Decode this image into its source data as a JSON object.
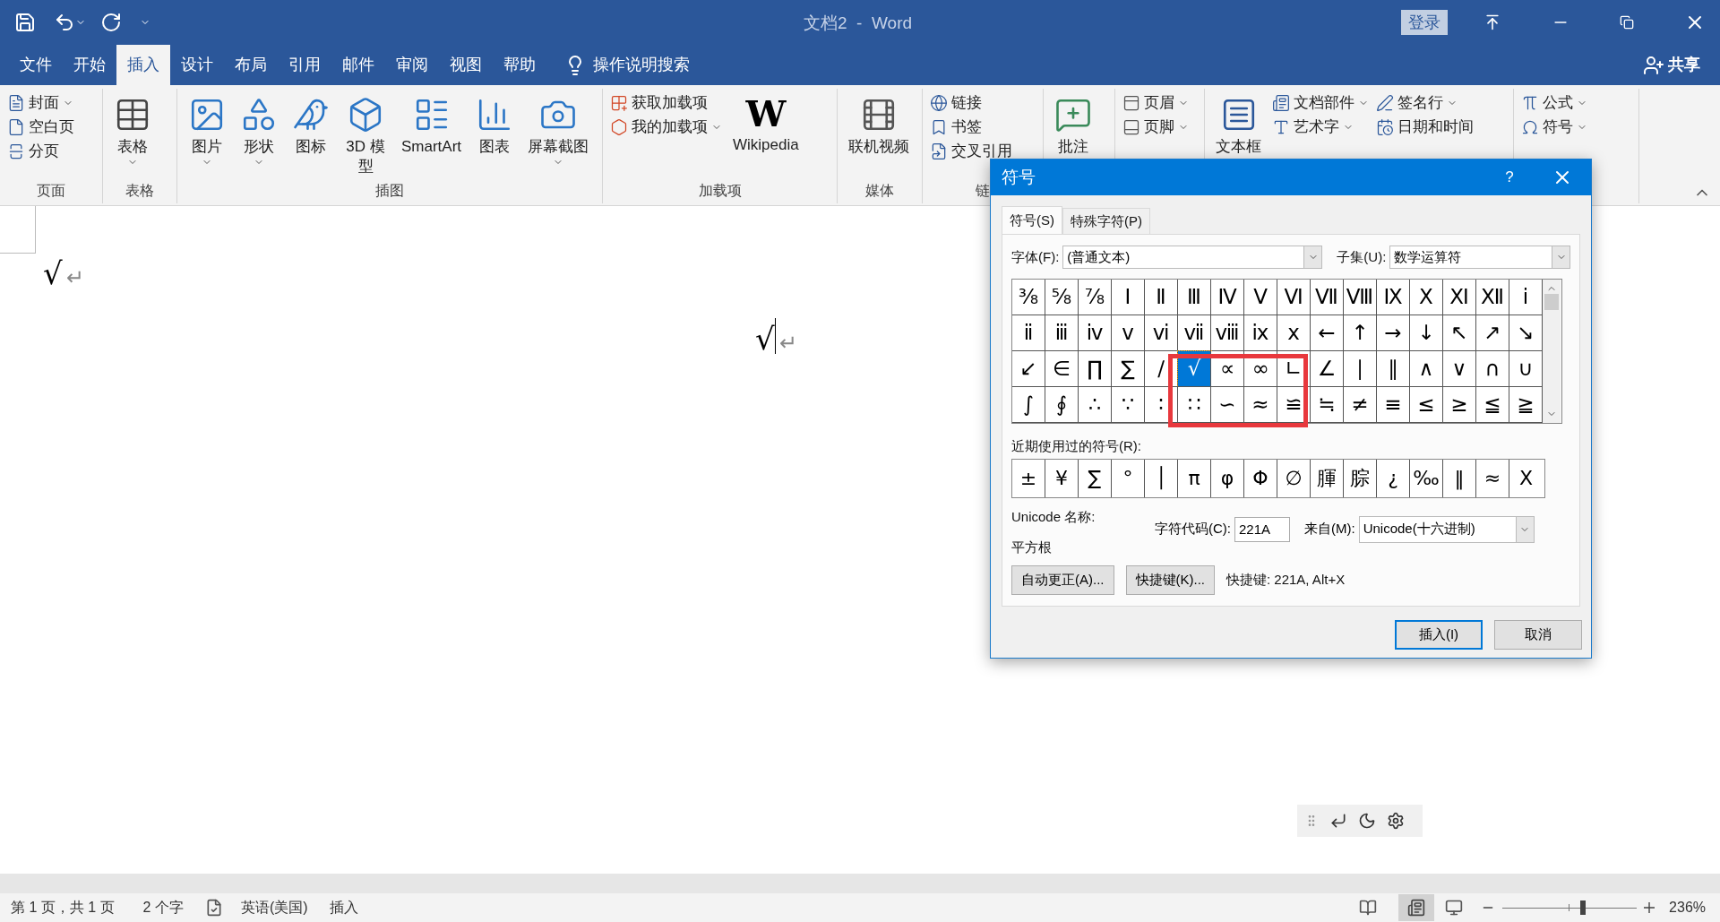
{
  "window": {
    "title": "文档2  -  Word",
    "signin": "登录"
  },
  "menu_tabs": [
    {
      "label": "文件",
      "selected": false
    },
    {
      "label": "开始",
      "selected": false
    },
    {
      "label": "插入",
      "selected": true
    },
    {
      "label": "设计",
      "selected": false
    },
    {
      "label": "布局",
      "selected": false
    },
    {
      "label": "引用",
      "selected": false
    },
    {
      "label": "邮件",
      "selected": false
    },
    {
      "label": "审阅",
      "selected": false
    },
    {
      "label": "视图",
      "selected": false
    },
    {
      "label": "帮助",
      "selected": false
    }
  ],
  "tell_me": "操作说明搜索",
  "share": "共享",
  "ribbon": {
    "groups": [
      {
        "label": "页面",
        "items": [
          {
            "label": "封面",
            "kind": "small",
            "dropdown": true
          },
          {
            "label": "空白页",
            "kind": "small",
            "dropdown": false
          },
          {
            "label": "分页",
            "kind": "small",
            "dropdown": false
          }
        ]
      },
      {
        "label": "表格",
        "items": [
          {
            "label": "表格",
            "kind": "large",
            "dropdown": true
          }
        ]
      },
      {
        "label": "插图",
        "items": [
          {
            "label": "图片",
            "kind": "large",
            "dropdown": true
          },
          {
            "label": "形状",
            "kind": "large",
            "dropdown": true
          },
          {
            "label": "图标",
            "kind": "large",
            "dropdown": false
          },
          {
            "label": "3D 模型",
            "kind": "large",
            "dropdown": false
          },
          {
            "label": "SmartArt",
            "kind": "large",
            "dropdown": false
          },
          {
            "label": "图表",
            "kind": "large",
            "dropdown": false
          },
          {
            "label": "屏幕截图",
            "kind": "large",
            "dropdown": true
          }
        ]
      },
      {
        "label": "加载项",
        "items": [
          {
            "label": "获取加载项",
            "kind": "small",
            "dropdown": false
          },
          {
            "label": "我的加载项",
            "kind": "small",
            "dropdown": true
          },
          {
            "label": "Wikipedia",
            "kind": "large",
            "dropdown": false,
            "logo": "W"
          }
        ]
      },
      {
        "label": "媒体",
        "items": [
          {
            "label": "联机视频",
            "kind": "large",
            "dropdown": false
          }
        ]
      },
      {
        "label": "链",
        "items": [
          {
            "label": "链接",
            "kind": "small",
            "dropdown": false
          },
          {
            "label": "书签",
            "kind": "small",
            "dropdown": false
          },
          {
            "label": "交叉引用",
            "kind": "small",
            "dropdown": false
          }
        ]
      },
      {
        "items": [
          {
            "label": "批注",
            "kind": "large",
            "dropdown": false
          }
        ]
      },
      {
        "items": [
          {
            "label": "页眉",
            "kind": "small",
            "dropdown": true
          },
          {
            "label": "页脚",
            "kind": "small",
            "dropdown": true
          }
        ]
      },
      {
        "items": [
          {
            "label": "文本框",
            "kind": "large",
            "dropdown": false
          },
          {
            "label": "文档部件",
            "kind": "small",
            "dropdown": true
          },
          {
            "label": "艺术字",
            "kind": "small",
            "dropdown": true
          },
          {
            "label": "签名行",
            "kind": "small",
            "dropdown": true
          },
          {
            "label": "日期和时间",
            "kind": "small",
            "dropdown": false
          }
        ]
      },
      {
        "items": [
          {
            "label": "公式",
            "kind": "small",
            "dropdown": true
          },
          {
            "label": "符号",
            "kind": "small",
            "dropdown": true
          }
        ]
      }
    ]
  },
  "document": {
    "paragraphs": [
      {
        "text": "√",
        "mark": "↵"
      },
      {
        "text": "√",
        "mark": "↵"
      }
    ]
  },
  "dialog": {
    "title": "符号",
    "help": "?",
    "tabs": [
      {
        "label": "符号(S)",
        "selected": true
      },
      {
        "label": "特殊字符(P)",
        "selected": false
      }
    ],
    "font_label": "字体(F):",
    "font_value": "(普通文本)",
    "subset_label": "子集(U):",
    "subset_value": "数学运算符",
    "symbols": [
      [
        {
          "s": "⅜",
          "selected": false
        },
        {
          "s": "⅝",
          "selected": false
        },
        {
          "s": "⅞",
          "selected": false
        },
        {
          "s": "Ⅰ",
          "selected": false
        },
        {
          "s": "Ⅱ",
          "selected": false
        },
        {
          "s": "Ⅲ",
          "selected": false
        },
        {
          "s": "Ⅳ",
          "selected": false
        },
        {
          "s": "Ⅴ",
          "selected": false
        },
        {
          "s": "Ⅵ",
          "selected": false
        },
        {
          "s": "Ⅶ",
          "selected": false
        },
        {
          "s": "Ⅷ",
          "selected": false
        },
        {
          "s": "Ⅸ",
          "selected": false
        },
        {
          "s": "Ⅹ",
          "selected": false
        },
        {
          "s": "Ⅺ",
          "selected": false
        },
        {
          "s": "Ⅻ",
          "selected": false
        },
        {
          "s": "ⅰ",
          "selected": false
        }
      ],
      [
        {
          "s": "ⅱ",
          "selected": false
        },
        {
          "s": "ⅲ",
          "selected": false
        },
        {
          "s": "ⅳ",
          "selected": false
        },
        {
          "s": "ⅴ",
          "selected": false
        },
        {
          "s": "ⅵ",
          "selected": false
        },
        {
          "s": "ⅶ",
          "selected": false
        },
        {
          "s": "ⅷ",
          "selected": false
        },
        {
          "s": "ⅸ",
          "selected": false
        },
        {
          "s": "ⅹ",
          "selected": false
        },
        {
          "s": "←",
          "selected": false
        },
        {
          "s": "↑",
          "selected": false
        },
        {
          "s": "→",
          "selected": false
        },
        {
          "s": "↓",
          "selected": false
        },
        {
          "s": "↖",
          "selected": false
        },
        {
          "s": "↗",
          "selected": false
        },
        {
          "s": "↘",
          "selected": false
        }
      ],
      [
        {
          "s": "↙",
          "selected": false
        },
        {
          "s": "∈",
          "selected": false
        },
        {
          "s": "∏",
          "selected": false
        },
        {
          "s": "∑",
          "selected": false
        },
        {
          "s": "∕",
          "selected": false
        },
        {
          "s": "√",
          "selected": true
        },
        {
          "s": "∝",
          "selected": false
        },
        {
          "s": "∞",
          "selected": false
        },
        {
          "s": "∟",
          "selected": false
        },
        {
          "s": "∠",
          "selected": false
        },
        {
          "s": "∣",
          "selected": false
        },
        {
          "s": "∥",
          "selected": false
        },
        {
          "s": "∧",
          "selected": false
        },
        {
          "s": "∨",
          "selected": false
        },
        {
          "s": "∩",
          "selected": false
        },
        {
          "s": "∪",
          "selected": false
        }
      ],
      [
        {
          "s": "∫",
          "selected": false
        },
        {
          "s": "∮",
          "selected": false
        },
        {
          "s": "∴",
          "selected": false
        },
        {
          "s": "∵",
          "selected": false
        },
        {
          "s": "∶",
          "selected": false
        },
        {
          "s": "∷",
          "selected": false
        },
        {
          "s": "∽",
          "selected": false
        },
        {
          "s": "≈",
          "selected": false
        },
        {
          "s": "≌",
          "selected": false
        },
        {
          "s": "≒",
          "selected": false
        },
        {
          "s": "≠",
          "selected": false
        },
        {
          "s": "≡",
          "selected": false
        },
        {
          "s": "≤",
          "selected": false
        },
        {
          "s": "≥",
          "selected": false
        },
        {
          "s": "≦",
          "selected": false
        },
        {
          "s": "≧",
          "selected": false
        }
      ]
    ],
    "recent_label": "近期使用过的符号(R):",
    "recent": [
      "±",
      "¥",
      "∑",
      "°",
      "│",
      "π",
      "φ",
      "Φ",
      "∅",
      "腪",
      "腙",
      "¿",
      "‰",
      "‖",
      "≈",
      "X"
    ],
    "unicode_name_label": "Unicode 名称:",
    "unicode_name": "平方根",
    "code_label": "字符代码(C):",
    "code_value": "221A",
    "from_label": "来自(M):",
    "from_value": "Unicode(十六进制)",
    "autocorrect": "自动更正(A)...",
    "shortcut_button": "快捷键(K)...",
    "shortcut_text": "快捷键: 221A, Alt+X",
    "insert": "插入(I)",
    "cancel": "取消"
  },
  "status_bar": {
    "page": "第 1 页，共 1 页",
    "words": "2 个字",
    "language": "英语(美国)",
    "mode": "插入",
    "zoom": {
      "level": 0.6
    },
    "zoom_text": "236%"
  }
}
